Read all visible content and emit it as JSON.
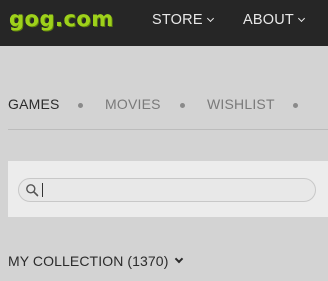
{
  "header": {
    "logo_text": "gog.com",
    "logo_color": "#9ed11b",
    "nav": [
      {
        "label": "STORE",
        "icon": "chevron-down-icon"
      },
      {
        "label": "ABOUT",
        "icon": "chevron-down-icon"
      }
    ]
  },
  "tabs": [
    {
      "label": "GAMES",
      "active": true
    },
    {
      "label": "MOVIES",
      "active": false
    },
    {
      "label": "WISHLIST",
      "active": false
    }
  ],
  "search": {
    "icon": "search-icon",
    "value": "",
    "placeholder": ""
  },
  "collection": {
    "label": "MY COLLECTION (1370)",
    "icon": "chevron-down-icon"
  }
}
